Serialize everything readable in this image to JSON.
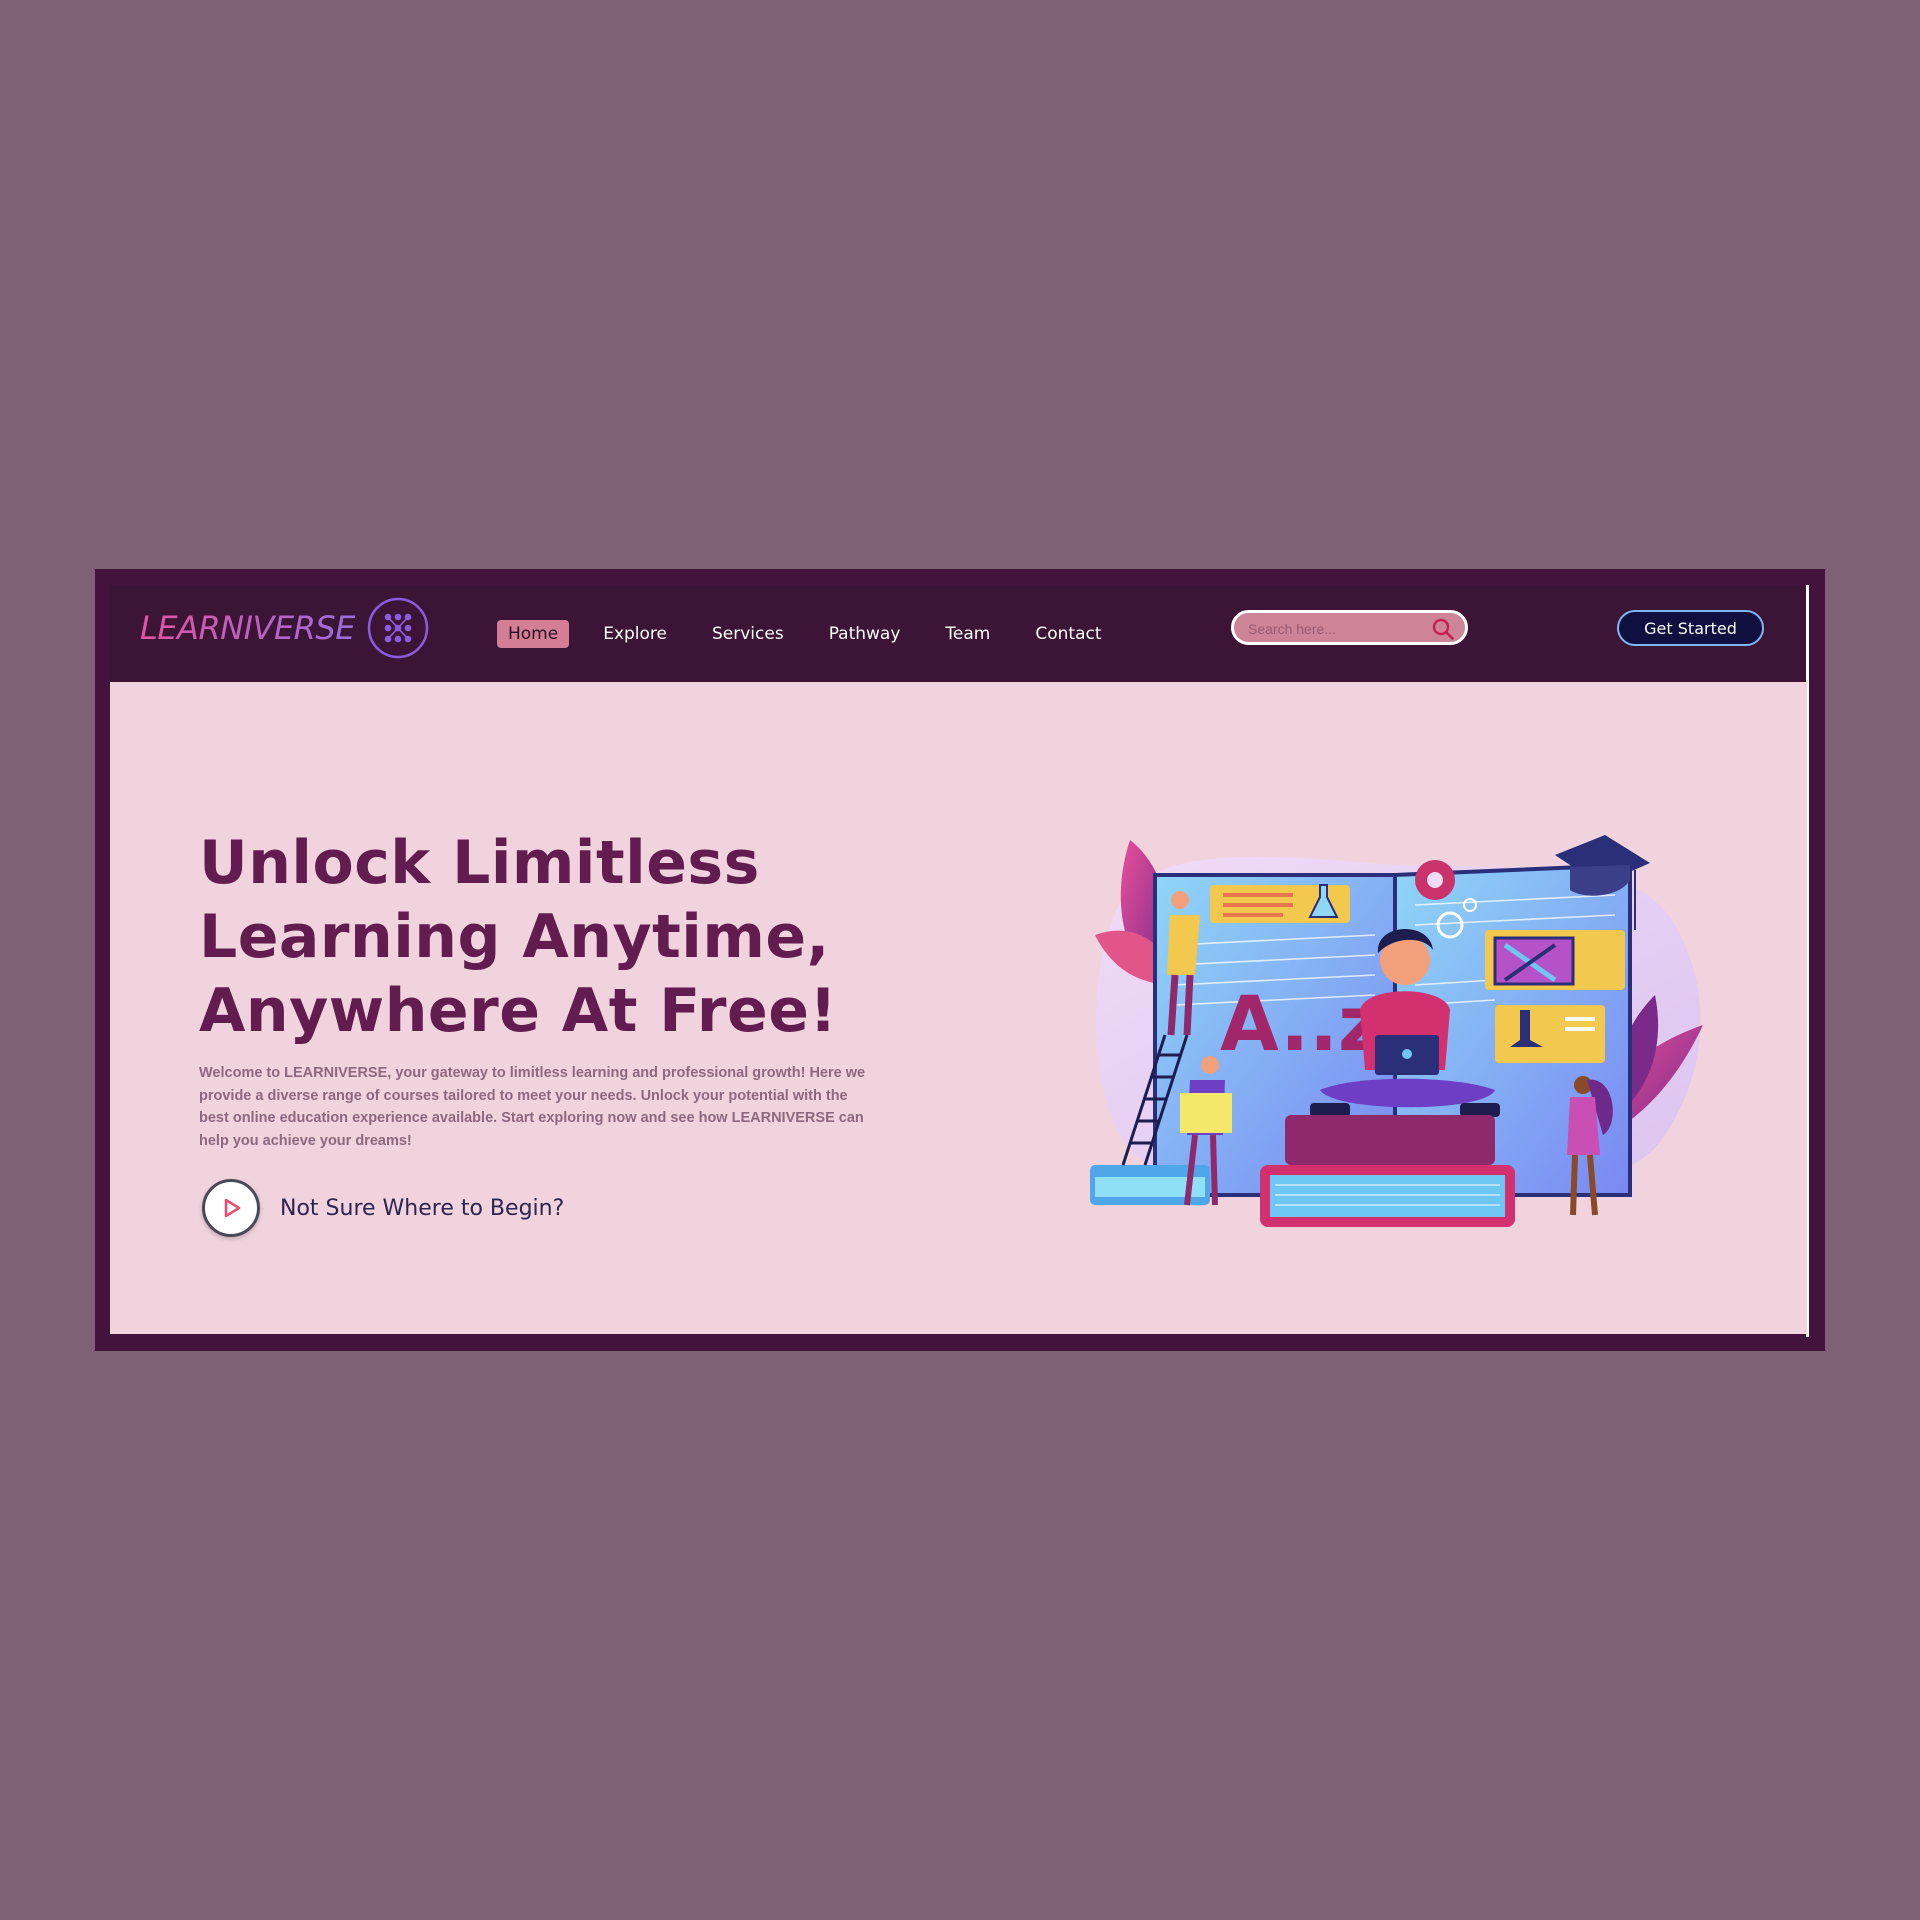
{
  "brand": {
    "name": "LEARNIVERSE",
    "icon": "dots-grid-logo-icon"
  },
  "nav": {
    "items": [
      {
        "label": "Home",
        "active": true
      },
      {
        "label": "Explore"
      },
      {
        "label": "Services"
      },
      {
        "label": "Pathway"
      },
      {
        "label": "Team"
      },
      {
        "label": "Contact"
      }
    ]
  },
  "search": {
    "placeholder": "Search here...",
    "value": "",
    "icon": "search-icon"
  },
  "cta": {
    "label": "Get Started"
  },
  "hero": {
    "headline": "Unlock Limitless Learning Anytime, Anywhere At Free!",
    "intro": "Welcome to LEARNIVERSE, your gateway to limitless learning and professional growth! Here we provide a diverse range of courses tailored to meet your needs. Unlock your potential with the best online education experience available. Start exploring now and see how LEARNIVERSE can help you achieve your dreams!",
    "video_label": "Not Sure Where to Begin?",
    "illustration_text": "A..z"
  },
  "colors": {
    "page_bg": "#7f6176",
    "frame": "#43133d",
    "hero_bg": "#f0d3dc",
    "headline": "#621c50",
    "active_nav": "#d37e94",
    "cta_bg": "#0f1040"
  }
}
